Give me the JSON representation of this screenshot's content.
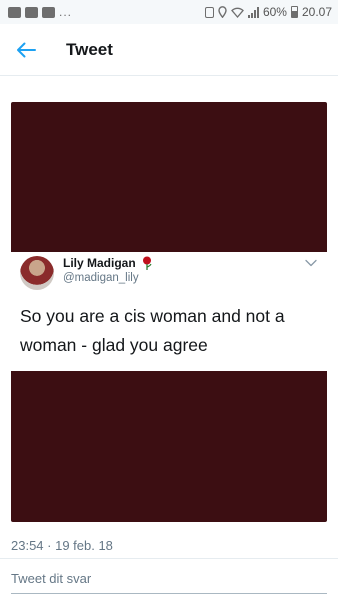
{
  "status_bar": {
    "left_icons": [
      "facebook-icon",
      "youtube-icon",
      "gallery-icon"
    ],
    "overflow": "...",
    "battery_percent": "60%",
    "time": "20.07"
  },
  "header": {
    "title": "Tweet",
    "back_icon": "arrow-left-icon",
    "accent": "#1da1f2"
  },
  "media": {
    "background_color": "#3c0e12",
    "quoted_tweet": {
      "display_name": "Lily Madigan",
      "name_emoji": "rose-icon",
      "handle": "@madigan_lily",
      "text": "So you are a cis woman and not a woman - glad you agree"
    }
  },
  "meta": {
    "timestamp": "23:54 · 19 feb. 18"
  },
  "reply": {
    "placeholder": "Tweet dit svar"
  }
}
